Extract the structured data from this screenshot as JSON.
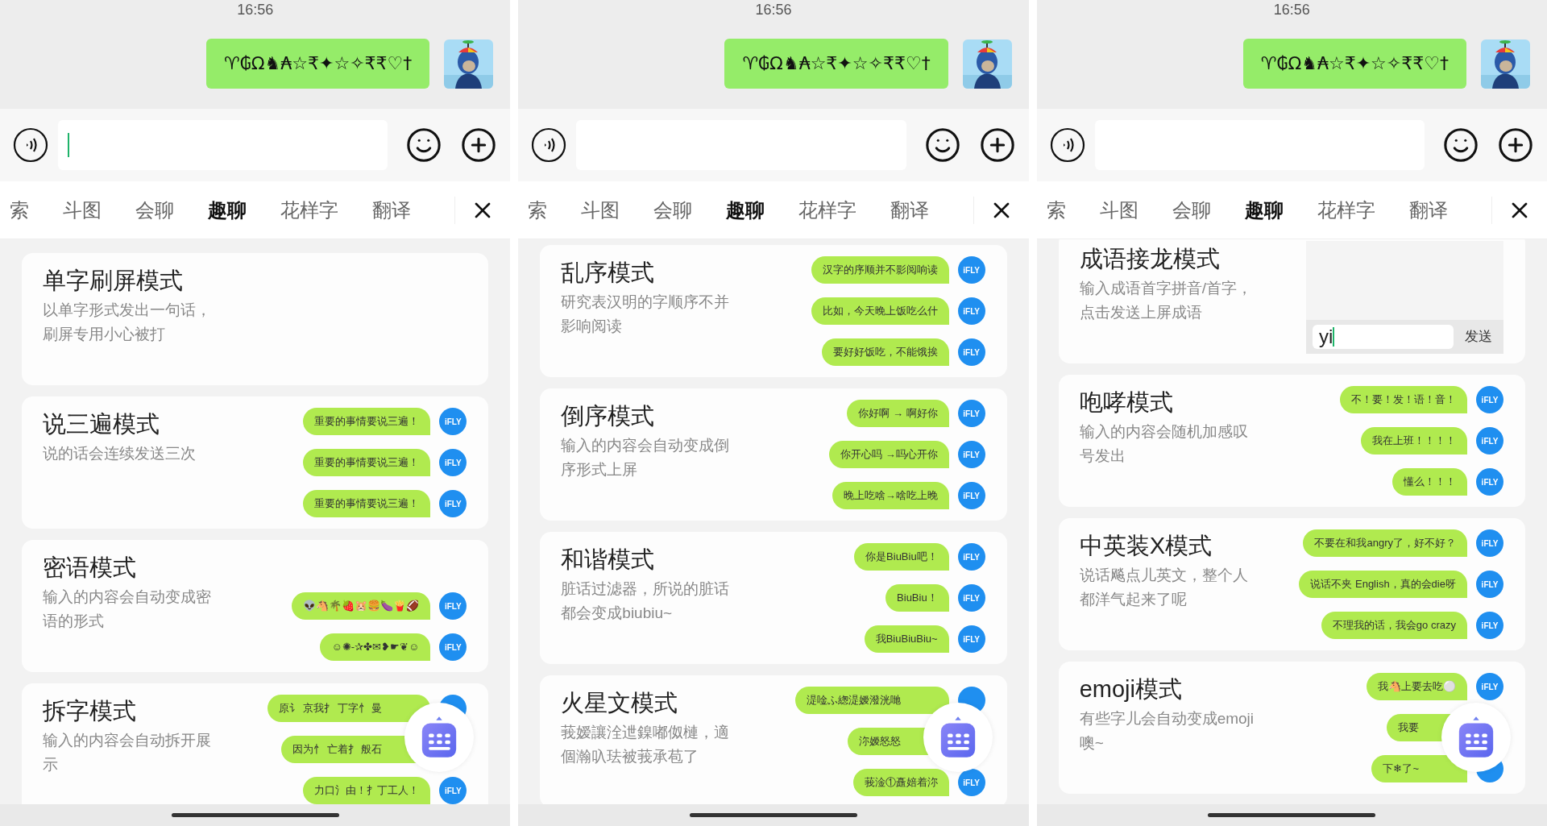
{
  "panels": [
    {
      "time": "16:56",
      "message": {
        "text": "♈₲Ω♞₳☆₹✦☆✧₹₹♡†"
      },
      "input": {
        "focused": true
      },
      "tabs": [
        {
          "label": "索",
          "selected": false
        },
        {
          "label": "斗图",
          "selected": false
        },
        {
          "label": "会聊",
          "selected": false
        },
        {
          "label": "趣聊",
          "selected": true
        },
        {
          "label": "花样字",
          "selected": false
        },
        {
          "label": "翻译",
          "selected": false
        }
      ],
      "cards": [
        {
          "kind": "plain",
          "title": "单字刷屏模式",
          "description": "以单字形式发出一句话，刷屏专用小心被打"
        },
        {
          "kind": "bubbles",
          "title": "说三遍模式",
          "description": "说的话会连续发送三次",
          "bubbles": [
            {
              "text": "重要的事情要说三遍！",
              "avatar": true,
              "badge": "iFLY"
            },
            {
              "text": "重要的事情要说三遍！",
              "avatar": true,
              "badge": "iFLY"
            },
            {
              "text": "重要的事情要说三遍！",
              "avatar": true,
              "badge": "iFLY"
            }
          ]
        },
        {
          "kind": "bubbles",
          "title": "密语模式",
          "description": "输入的内容会自动变成密语的形式",
          "bubbles": [
            {
              "text": "👽🐴🌴🍓🐹🍔🍆🍟🏈",
              "avatar": true,
              "badge": "iFLY"
            },
            {
              "text": "☺✺-✰✤✉❥☛❦☺",
              "avatar": true,
              "badge": "iFLY"
            }
          ]
        },
        {
          "kind": "bubbles",
          "title": "拆字模式",
          "description": "输入的内容会自动拆开展示",
          "bubbles": [
            {
              "text": "原讠 京我扌 丁字忄 曼",
              "avatar": true
            },
            {
              "text": "因为忄 亡着扌 般石",
              "avatar": false
            },
            {
              "text": "力口氵由！扌丁工人！",
              "avatar": true,
              "badge": "iFLY"
            }
          ]
        }
      ]
    },
    {
      "time": "16:56",
      "message": {
        "text": "♈₲Ω♞₳☆₹✦☆✧₹₹♡†"
      },
      "input": {
        "focused": false
      },
      "tabs": [
        {
          "label": "索",
          "selected": false
        },
        {
          "label": "斗图",
          "selected": false
        },
        {
          "label": "会聊",
          "selected": false
        },
        {
          "label": "趣聊",
          "selected": true
        },
        {
          "label": "花样字",
          "selected": false
        },
        {
          "label": "翻译",
          "selected": false
        }
      ],
      "cards": [
        {
          "kind": "bubbles",
          "title": "乱序模式",
          "description": "研究表汉明的字顺序不并影响阅读",
          "bubbles": [
            {
              "text": "汉字的序顺并不影阅响读",
              "avatar": true,
              "badge": "iFLY"
            },
            {
              "text": "比如，今天晚上饭吃么什",
              "avatar": true,
              "badge": "iFLY"
            },
            {
              "text": "要好好饭吃，不能饿挨",
              "avatar": true,
              "badge": "iFLY"
            }
          ]
        },
        {
          "kind": "bubbles",
          "title": "倒序模式",
          "description": "输入的内容会自动变成倒序形式上屏",
          "bubbles": [
            {
              "text": "你好啊 → 啊好你",
              "avatar": true,
              "badge": "iFLY"
            },
            {
              "text": "你开心吗 →吗心开你",
              "avatar": true,
              "badge": "iFLY"
            },
            {
              "text": "晚上吃啥→啥吃上晚",
              "avatar": true,
              "badge": "iFLY"
            }
          ]
        },
        {
          "kind": "bubbles",
          "title": "和谐模式",
          "description": "脏话过滤器，所说的脏话都会变成biubiu~",
          "bubbles": [
            {
              "text": "你是BiuBiu吧！",
              "avatar": true,
              "badge": "iFLY"
            },
            {
              "text": "BiuBiu！",
              "avatar": true,
              "badge": "iFLY"
            },
            {
              "text": "我BiuBiuBiu~",
              "avatar": true,
              "badge": "iFLY"
            }
          ]
        },
        {
          "kind": "bubbles",
          "title": "火星文模式",
          "description": "莪嫒讓洤迣鎳嘟伮槤，適個瀚叺珐被莪承苞了",
          "bubbles": [
            {
              "text": "湜唫ふ緫湜嫒潑洸哋",
              "avatar": true
            },
            {
              "text": "沵嫒怒怒",
              "avatar": false
            },
            {
              "text": "莪淦①矗婄着沵",
              "avatar": true,
              "badge": "iFLY"
            }
          ]
        }
      ]
    },
    {
      "time": "16:56",
      "message": {
        "text": "♈₲Ω♞₳☆₹✦☆✧₹₹♡†"
      },
      "input": {
        "focused": false
      },
      "tabs": [
        {
          "label": "索",
          "selected": false
        },
        {
          "label": "斗图",
          "selected": false
        },
        {
          "label": "会聊",
          "selected": false
        },
        {
          "label": "趣聊",
          "selected": true
        },
        {
          "label": "花样字",
          "selected": false
        },
        {
          "label": "翻译",
          "selected": false
        }
      ],
      "cards": [
        {
          "kind": "demo",
          "title": "成语接龙模式",
          "description": "输入成语首字拼音/首字，点击发送上屏成语",
          "demo": {
            "value": "yi",
            "focused": true,
            "button": "发送"
          }
        },
        {
          "kind": "bubbles",
          "title": "咆哮模式",
          "description": "输入的内容会随机加感叹号发出",
          "bubbles": [
            {
              "text": "不！要！发！语！音！",
              "avatar": true,
              "badge": "iFLY"
            },
            {
              "text": "我在上班！！！！",
              "avatar": true,
              "badge": "iFLY"
            },
            {
              "text": "懂么！！！",
              "avatar": true,
              "badge": "iFLY"
            }
          ]
        },
        {
          "kind": "bubbles",
          "title": "中英装X模式",
          "description": "说话飚点儿英文，整个人都洋气起来了呢",
          "bubbles": [
            {
              "text": "不要在和我angry了，好不好？",
              "avatar": true,
              "badge": "iFLY"
            },
            {
              "text": "说话不夹 English，真的会die呀",
              "avatar": true,
              "badge": "iFLY"
            },
            {
              "text": "不理我的话，我会go crazy",
              "avatar": true,
              "badge": "iFLY"
            }
          ]
        },
        {
          "kind": "bubbles",
          "title": "emoji模式",
          "description": "有些字儿会自动变成emoji噢~",
          "bubbles": [
            {
              "text": "我🐴上要去吃⚪",
              "avatar": true,
              "badge": "iFLY"
            },
            {
              "text": "我要",
              "avatar": false
            },
            {
              "text": "下❄了~",
              "avatar": true
            }
          ]
        }
      ]
    }
  ]
}
